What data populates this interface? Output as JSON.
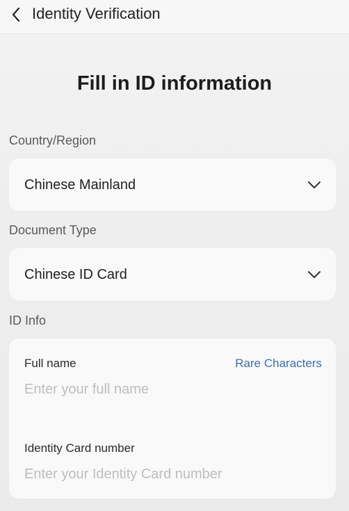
{
  "nav": {
    "back_icon": "chevron-left-icon",
    "title": "Identity Verification"
  },
  "page": {
    "title": "Fill in ID information"
  },
  "country": {
    "label": "Country/Region",
    "value": "Chinese Mainland",
    "icon": "chevron-down-icon"
  },
  "document": {
    "label": "Document Type",
    "value": "Chinese ID Card",
    "icon": "chevron-down-icon"
  },
  "id_info": {
    "label": "ID Info",
    "full_name": {
      "label": "Full name",
      "value": "",
      "placeholder": "Enter your full name",
      "rare_link": "Rare Characters"
    },
    "id_number": {
      "label": "Identity Card number",
      "value": "",
      "placeholder": "Enter your Identity Card number"
    }
  },
  "colors": {
    "background": "#efefef",
    "card": "#f9f9f9",
    "link": "#3d6ea8",
    "placeholder": "#bdbdbd"
  }
}
